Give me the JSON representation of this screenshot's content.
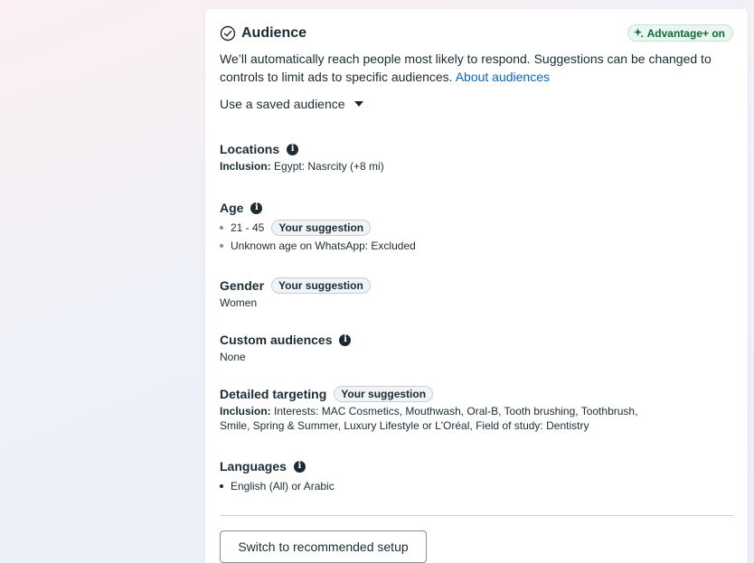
{
  "header": {
    "title": "Audience",
    "badge": "Advantage+ on"
  },
  "description": {
    "text": "We’ll automatically reach people most likely to respond. Suggestions can be changed to controls to limit ads to specific audiences.",
    "link": "About audiences"
  },
  "saved_audience": {
    "label": "Use a saved audience"
  },
  "locations": {
    "title": "Locations",
    "prefix": "Inclusion:",
    "value": "Egypt: Nasrcity (+8 mi)"
  },
  "age": {
    "title": "Age",
    "items": [
      {
        "text": "21 - 45",
        "pill": "Your suggestion"
      },
      {
        "text": "Unknown age on WhatsApp: Excluded"
      }
    ]
  },
  "gender": {
    "title": "Gender",
    "pill": "Your suggestion",
    "value": "Women"
  },
  "custom_audiences": {
    "title": "Custom audiences",
    "value": "None"
  },
  "detailed_targeting": {
    "title": "Detailed targeting",
    "pill": "Your suggestion",
    "prefix": "Inclusion:",
    "line1": "Interests: MAC Cosmetics, Mouthwash, Oral-B, Tooth brushing, Toothbrush,",
    "line2": "Smile, Spring & Summer, Luxury Lifestyle or L'Oréal, Field of study: Dentistry"
  },
  "languages": {
    "title": "Languages",
    "items": [
      "English (All) or Arabic"
    ]
  },
  "footer": {
    "button": "Switch to recommended setup"
  },
  "colors": {
    "accent_link": "#0a66c2",
    "badge_green": "#0b6b3a"
  }
}
